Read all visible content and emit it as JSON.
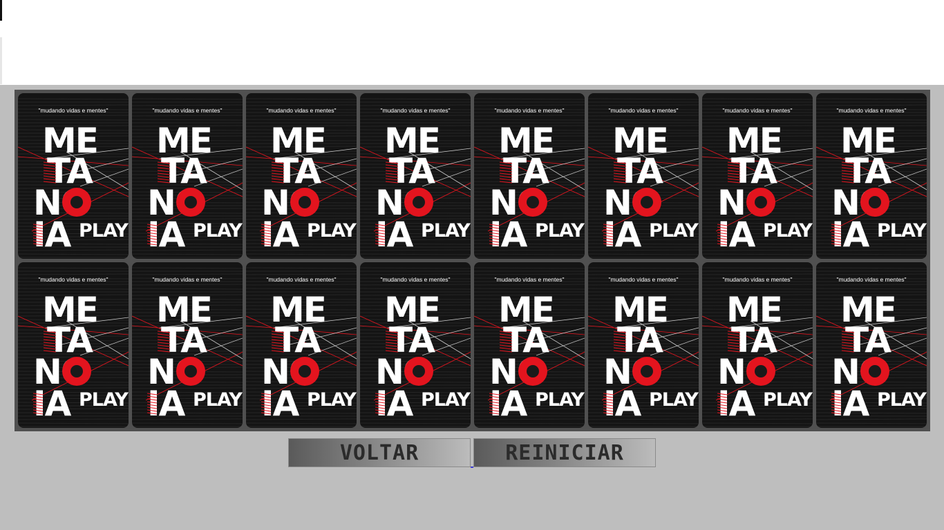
{
  "game": {
    "card_back": {
      "tagline": "\"mudando vidas e mentes\"",
      "logo_lines": [
        "ME",
        "TA",
        "NO",
        "IA"
      ],
      "logo_play": "PLAY",
      "colors": {
        "card": "#141414",
        "accent": "#e3141e",
        "text": "#ffffff"
      }
    },
    "grid": {
      "rows": 2,
      "columns": 8
    },
    "cards_face_down": 16
  },
  "controls": {
    "back_label": "VOLTAR",
    "restart_label": "REINICIAR"
  }
}
